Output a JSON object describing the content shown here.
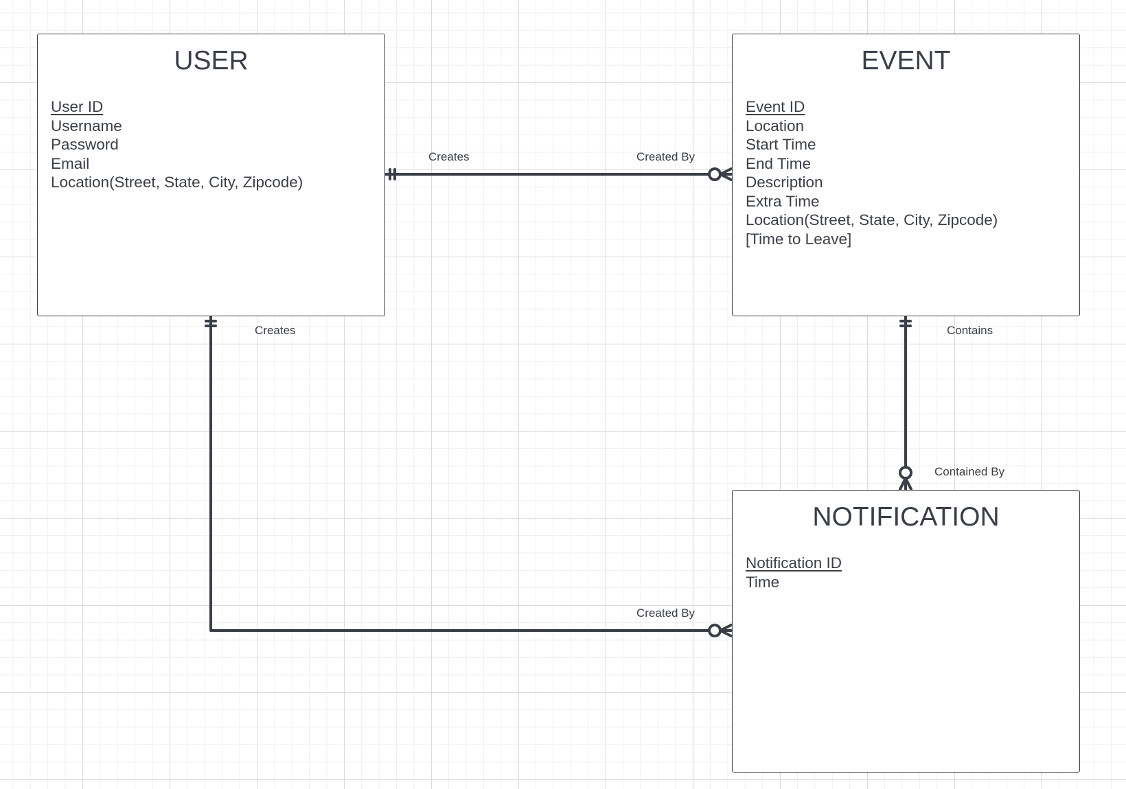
{
  "entities": {
    "user": {
      "title": "USER",
      "attributes": [
        {
          "text": "User ID",
          "primary_key": true
        },
        {
          "text": "Username",
          "primary_key": false
        },
        {
          "text": "Password",
          "primary_key": false
        },
        {
          "text": "Email",
          "primary_key": false
        },
        {
          "text": "Location(Street, State, City, Zipcode)",
          "primary_key": false
        }
      ]
    },
    "event": {
      "title": "EVENT",
      "attributes": [
        {
          "text": "Event ID",
          "primary_key": true
        },
        {
          "text": "Location",
          "primary_key": false
        },
        {
          "text": "Start Time",
          "primary_key": false
        },
        {
          "text": "End Time",
          "primary_key": false
        },
        {
          "text": "Description",
          "primary_key": false
        },
        {
          "text": "Extra Time",
          "primary_key": false
        },
        {
          "text": "Location(Street, State, City, Zipcode)",
          "primary_key": false
        },
        {
          "text": "[Time to Leave]",
          "primary_key": false
        }
      ]
    },
    "notification": {
      "title": "NOTIFICATION",
      "attributes": [
        {
          "text": "Notification ID",
          "primary_key": true
        },
        {
          "text": "Time",
          "primary_key": false
        }
      ]
    }
  },
  "relationships": {
    "user_event": {
      "from_label": "Creates",
      "to_label": "Created By",
      "from_cardinality": "exactly-one",
      "to_cardinality": "zero-or-many"
    },
    "user_notification": {
      "from_label": "Creates",
      "to_label": "Created By",
      "from_cardinality": "exactly-one",
      "to_cardinality": "zero-or-many"
    },
    "event_notification": {
      "from_label": "Contains",
      "to_label": "Contained By",
      "from_cardinality": "exactly-one",
      "to_cardinality": "zero-or-many"
    }
  },
  "colors": {
    "line": "#3a3f47",
    "grid_major": "#d9dbe0",
    "grid_minor": "#eef0f2"
  }
}
